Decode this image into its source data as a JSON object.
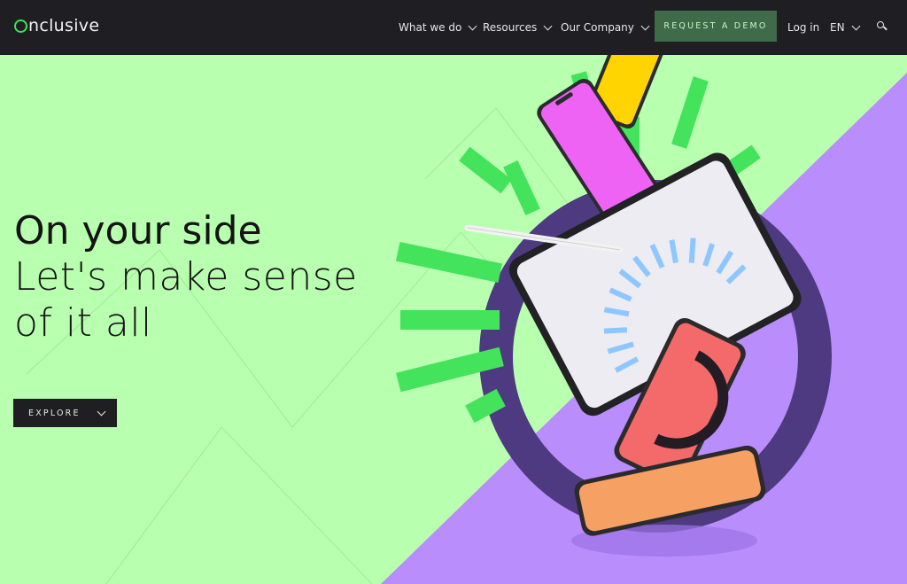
{
  "brand": {
    "name": "nclusive",
    "logo_letter": "O"
  },
  "nav": {
    "items": [
      {
        "label": "What we do"
      },
      {
        "label": "Resources"
      },
      {
        "label": "Our Company"
      }
    ],
    "demo_button": "REQUEST A DEMO",
    "login": "Log in",
    "language": "EN"
  },
  "hero": {
    "title": "On your side",
    "subtitle_line1": "Let's make sense",
    "subtitle_line2": "of it all",
    "explore_button": "EXPLORE"
  },
  "colors": {
    "nav_bg": "#1f1e22",
    "hero_green": "#b9ffb0",
    "accent_green": "#3fe05a",
    "purple": "#b98dfb",
    "dark_purple": "#4e3a80",
    "demo_button_bg": "#3f6b4a"
  }
}
